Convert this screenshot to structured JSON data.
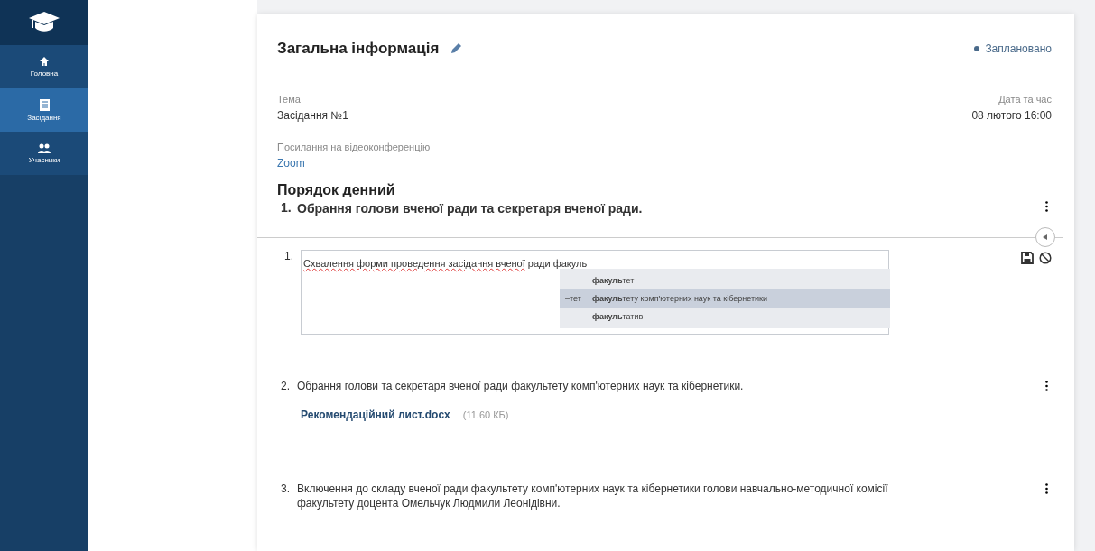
{
  "sidebar": {
    "items": [
      {
        "label": "Головна",
        "selected": false
      },
      {
        "label": "Засідання",
        "selected": true
      },
      {
        "label": "Учасники",
        "selected": false
      }
    ]
  },
  "general": {
    "title": "Загальна інформація",
    "status": {
      "label": "Заплановано",
      "color": "#4a6a8a"
    },
    "topic_label": "Тема",
    "topic": "Засідання №1",
    "date_label": "Дата та час",
    "date": "08 лютого 16:00",
    "link_label": "Посилання на відеоконференцію",
    "link": "Zoom"
  },
  "agenda": {
    "title": "Порядок денний",
    "heading": {
      "number": "1.",
      "text": "Обрання голови вченої ради та секретаря вченої ради."
    },
    "editor": {
      "number": "1.",
      "flagged": "Схвалення форми проведення засідання вченої",
      "rest": " ради факуль",
      "suggestions": [
        {
          "text": "**факуль**тет",
          "selected": false
        },
        {
          "prefix": "–тет",
          "text": "**факуль**тету комп'ютерних наук та кібернетики",
          "selected": true
        },
        {
          "text": "**факуль**татив",
          "selected": false
        }
      ]
    },
    "items": [
      {
        "number": "2.",
        "text": "Обрання голови та секретаря вченої ради факультету комп'ютерних наук та кібернетики.",
        "attachment": {
          "name": "Рекомендаційний лист.docx",
          "size": "(11.60 КБ)"
        }
      },
      {
        "number": "3.",
        "text": "Включення до складу вченої ради факультету комп'ютерних наук та кібернетики голови навчально-методичної комісії факультету доцента Омельчук Людмили Леонідівни."
      }
    ]
  }
}
